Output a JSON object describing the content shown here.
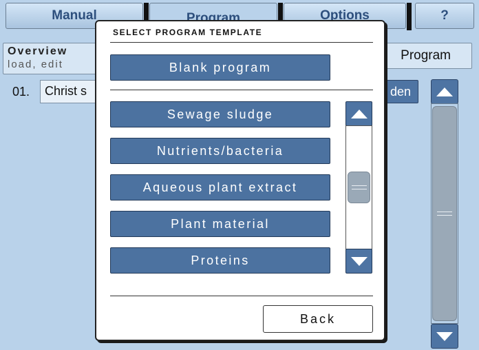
{
  "tabs": [
    {
      "label": "Manual"
    },
    {
      "label": "Program"
    },
    {
      "label": "Options"
    },
    {
      "label": "?"
    }
  ],
  "overview": {
    "title": "Overview",
    "subtitle": "load, edit"
  },
  "new_program_label": "Program",
  "program_list": {
    "number": "01.",
    "name": "Christ s"
  },
  "hidden_button_label": "den",
  "modal": {
    "title": "SELECT PROGRAM TEMPLATE",
    "blank_label": "Blank program",
    "templates": [
      {
        "label": "Sewage sludge"
      },
      {
        "label": "Nutrients/bacteria"
      },
      {
        "label": "Aqueous plant extract"
      },
      {
        "label": "Plant material"
      },
      {
        "label": "Proteins"
      }
    ],
    "back_label": "Back"
  },
  "icons": {
    "scroll_up": "triangle-up-icon",
    "scroll_down": "triangle-down-icon",
    "scroll_grip": "grip-icon"
  },
  "colors": {
    "background": "#b9d2ea",
    "button": "#4c72a0",
    "tab_text": "#2d4f7d"
  }
}
